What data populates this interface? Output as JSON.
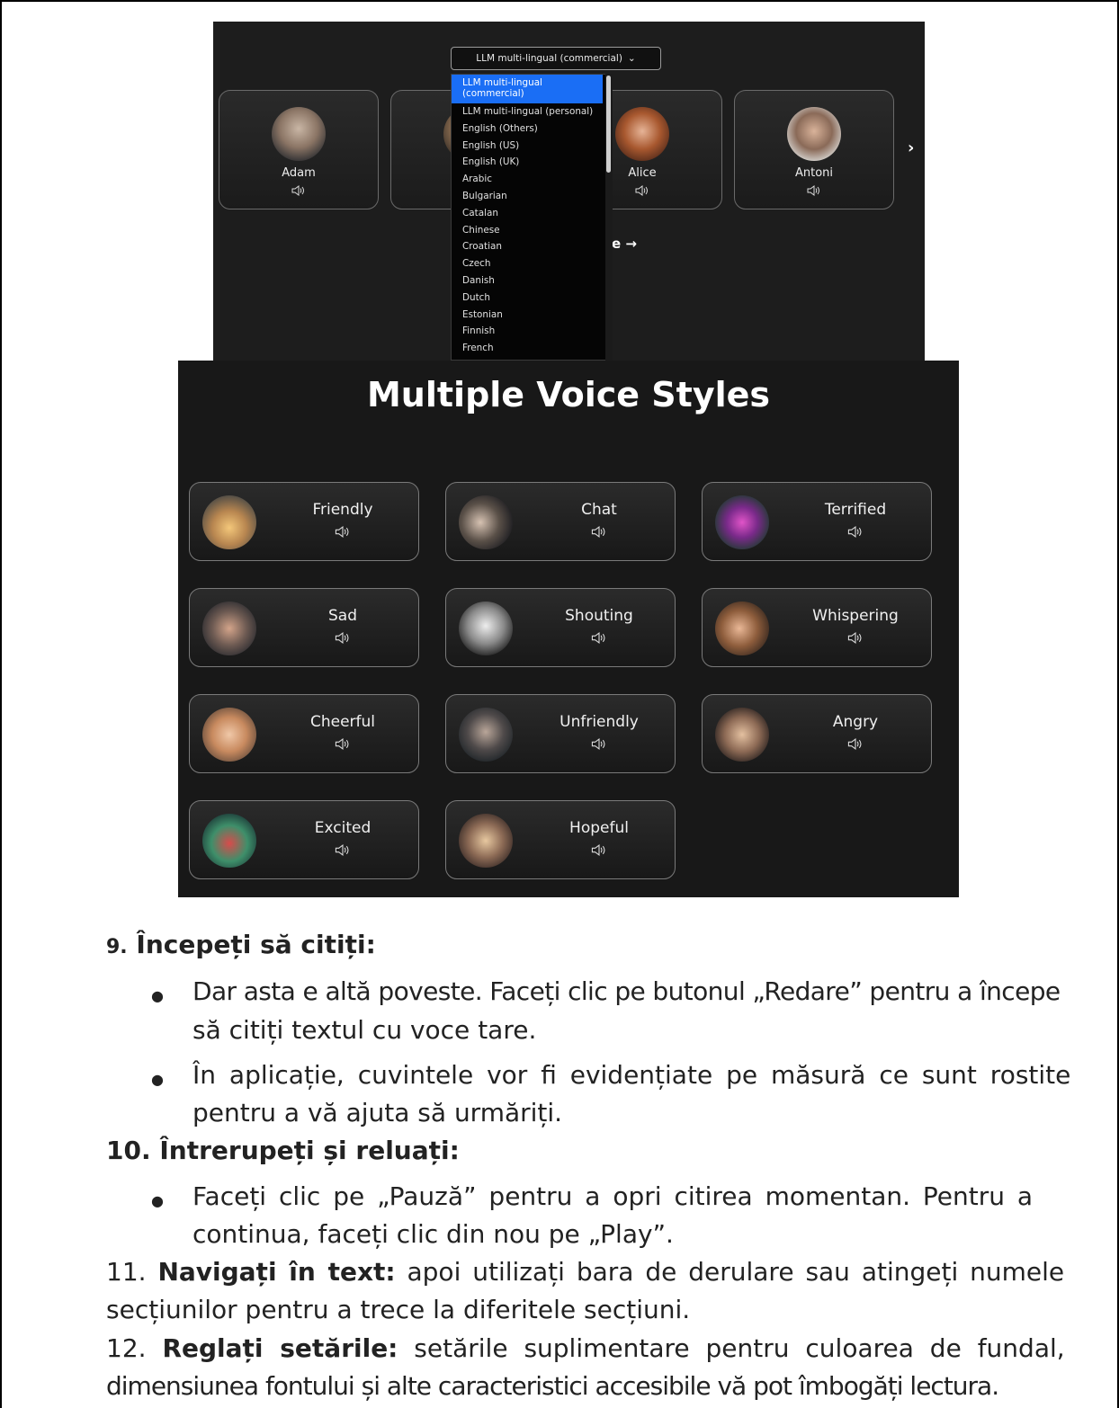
{
  "voice_picker": {
    "selected_model": "LLM multi-lingual (commercial)",
    "chevron": "chevron-down-icon",
    "dropdown_options": [
      "LLM multi-lingual (commercial)",
      "LLM multi-lingual (personal)",
      "English (Others)",
      "English (US)",
      "English (UK)",
      "Arabic",
      "Bulgarian",
      "Catalan",
      "Chinese",
      "Croatian",
      "Czech",
      "Danish",
      "Dutch",
      "Estonian",
      "Finnish",
      "French"
    ],
    "voices": [
      {
        "name": "Adam"
      },
      {
        "name": ""
      },
      {
        "name": "Alice"
      },
      {
        "name": "Antoni"
      }
    ],
    "next_arrow": "›",
    "see_more_partial": "e →"
  },
  "voice_styles": {
    "title": "Multiple Voice Styles",
    "styles": [
      {
        "name": "Friendly"
      },
      {
        "name": "Chat"
      },
      {
        "name": "Terrified"
      },
      {
        "name": "Sad"
      },
      {
        "name": "Shouting"
      },
      {
        "name": "Whispering"
      },
      {
        "name": "Cheerful"
      },
      {
        "name": "Unfriendly"
      },
      {
        "name": "Angry"
      },
      {
        "name": "Excited"
      },
      {
        "name": "Hopeful"
      }
    ]
  },
  "document": {
    "s9_num": "9.",
    "s9_title": "Începeți să citiți:",
    "s9_b1_l1": "Dar asta e altă poveste. Faceți clic pe butonul „Redare” pentru a începe",
    "s9_b1_l2": "să citiți textul cu voce tare.",
    "s9_b2_l1": "În aplicație, cuvintele vor fi evidențiate pe măsură ce sunt rostite",
    "s9_b2_l2": "pentru a vă ajuta să urmăriți.",
    "s10_title": "10. Întrerupeți și reluați:",
    "s10_b1_l1": "Faceți clic pe „Pauză” pentru a opri citirea momentan. Pentru a",
    "s10_b1_l2": "continua, faceți clic din nou pe „Play”.",
    "s11_num": "11.",
    "s11_title": "Navigați în text:",
    "s11_l1_rest": "apoi utilizați bara de derulare sau atingeți numele",
    "s11_l2": "secțiunilor pentru a trece la diferitele secțiuni.",
    "s12_num": "12.",
    "s12_title": "Reglați setările:",
    "s12_l1_rest": "setările suplimentare pentru culoarea de fundal,",
    "s12_l2": "dimensiunea fontului și alte caracteristici accesibile vă pot îmbogăți lectura."
  }
}
